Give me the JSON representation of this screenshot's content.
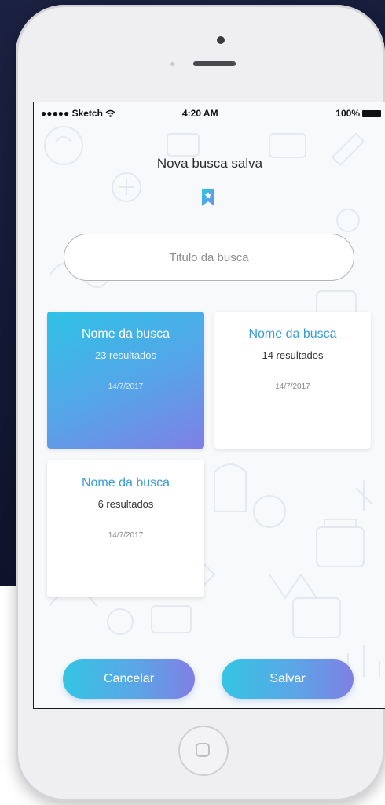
{
  "status_bar": {
    "carrier": "●●●●● Sketch",
    "time": "4:20 AM",
    "battery": "100%"
  },
  "screen_title": "Nova busca salva",
  "search": {
    "placeholder": "Titulo da busca"
  },
  "cards": [
    {
      "name": "Nome da busca",
      "count": "23 resultados",
      "date": "14/7/2017",
      "selected": true
    },
    {
      "name": "Nome da busca",
      "count": "14 resultados",
      "date": "14/7/2017",
      "selected": false
    },
    {
      "name": "Nome da busca",
      "count": "6 resultados",
      "date": "14/7/2017",
      "selected": false
    }
  ],
  "buttons": {
    "cancel": "Cancelar",
    "save": "Salvar"
  },
  "icons": {
    "bookmark": "bookmark-star-icon",
    "wifi": "wifi-icon",
    "battery": "battery-icon",
    "home": "home-button-icon"
  },
  "colors": {
    "accent_start": "#2ec2e6",
    "accent_end": "#7f7fe6",
    "card_title": "#3a9bd6",
    "background_dark": "#121833"
  }
}
